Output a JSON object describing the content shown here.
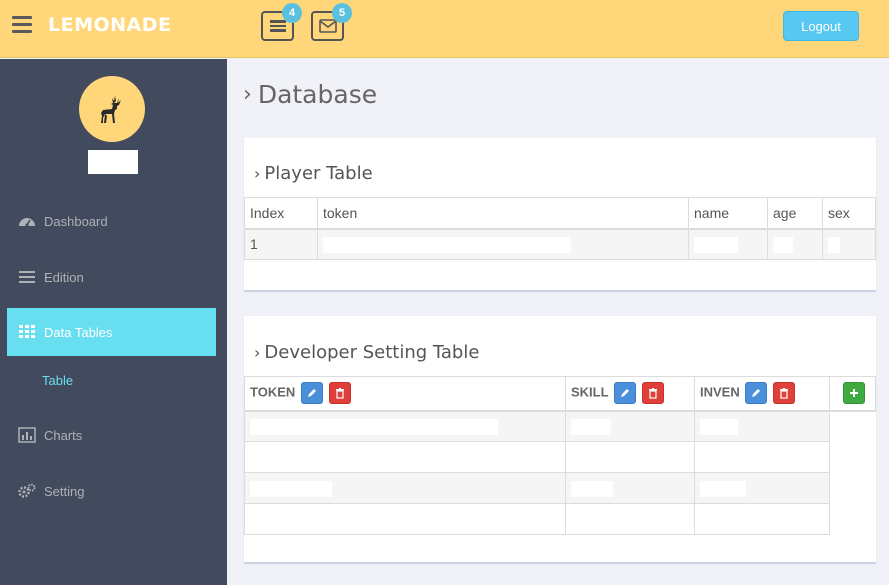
{
  "header": {
    "logo": "LEMONADE",
    "tasks_badge": "4",
    "mail_badge": "5",
    "logout_label": "Logout"
  },
  "sidebar": {
    "items": [
      {
        "label": "Dashboard",
        "icon": "dashboard-icon"
      },
      {
        "label": "Edition",
        "icon": "list-icon"
      },
      {
        "label": "Data Tables",
        "icon": "grid-icon",
        "active": true
      },
      {
        "label": "Charts",
        "icon": "bar-chart-icon"
      },
      {
        "label": "Setting",
        "icon": "gears-icon"
      }
    ],
    "sub_item": "Table"
  },
  "main": {
    "page_title": "Database",
    "player_table": {
      "title": "Player Table",
      "columns": [
        "Index",
        "token",
        "name",
        "age",
        "sex"
      ],
      "rows": [
        [
          "1",
          "",
          "",
          "",
          ""
        ]
      ]
    },
    "dev_table": {
      "title": "Developer Setting Table",
      "columns": [
        "TOKEN",
        "SKILL",
        "INVEN"
      ]
    }
  },
  "colors": {
    "header_bg": "#ffd77a",
    "sidebar_bg": "#424a5d",
    "accent": "#68dff0"
  }
}
